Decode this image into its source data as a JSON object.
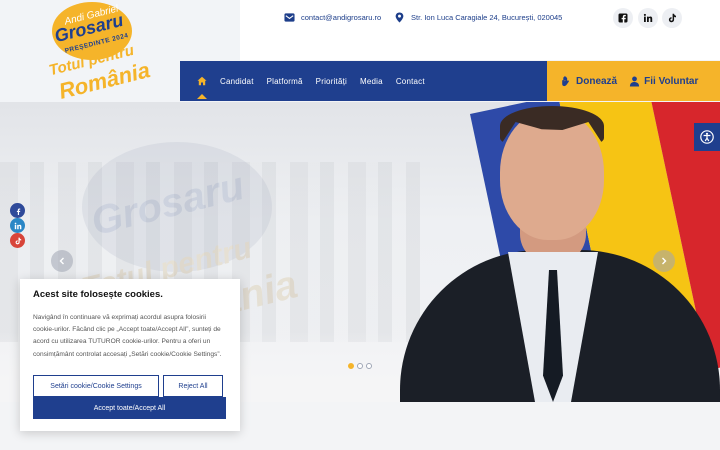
{
  "logo": {
    "line1": "Andi Gabriel",
    "line2": "Grosaru",
    "line3": "PREȘEDINTE 2024",
    "line4": "Totul pentru",
    "line5": "România"
  },
  "topbar": {
    "email": "contact@andigrosaru.ro",
    "address": "Str. Ion Luca Caragiale 24, București, 020045",
    "social": [
      "facebook-icon",
      "linkedin-icon",
      "tiktok-icon"
    ]
  },
  "nav": {
    "items": [
      "Candidat",
      "Platformă",
      "Priorități",
      "Media",
      "Contact"
    ]
  },
  "cta": {
    "donate": "Donează",
    "volunteer": "Fii Voluntar"
  },
  "hero": {
    "slides": 3,
    "active_slide": 1
  },
  "cookie": {
    "title": "Acest site folosește cookies.",
    "text": "Navigând în continuare vă exprimați acordul asupra folosirii cookie-urilor. Făcând clic pe „Accept toate/Accept All”, sunteți de acord cu utilizarea TUTUROR cookie-urilor. Pentru a oferi un consimțământ controlat accesați „Setări cookie/Cookie Settings”.",
    "settings_label": "Setări cookie/Cookie Settings",
    "reject_label": "Reject All",
    "accept_label": "Accept toate/Accept All"
  },
  "colors": {
    "brand_blue": "#1f3f8e",
    "brand_yellow": "#f5b42a"
  }
}
